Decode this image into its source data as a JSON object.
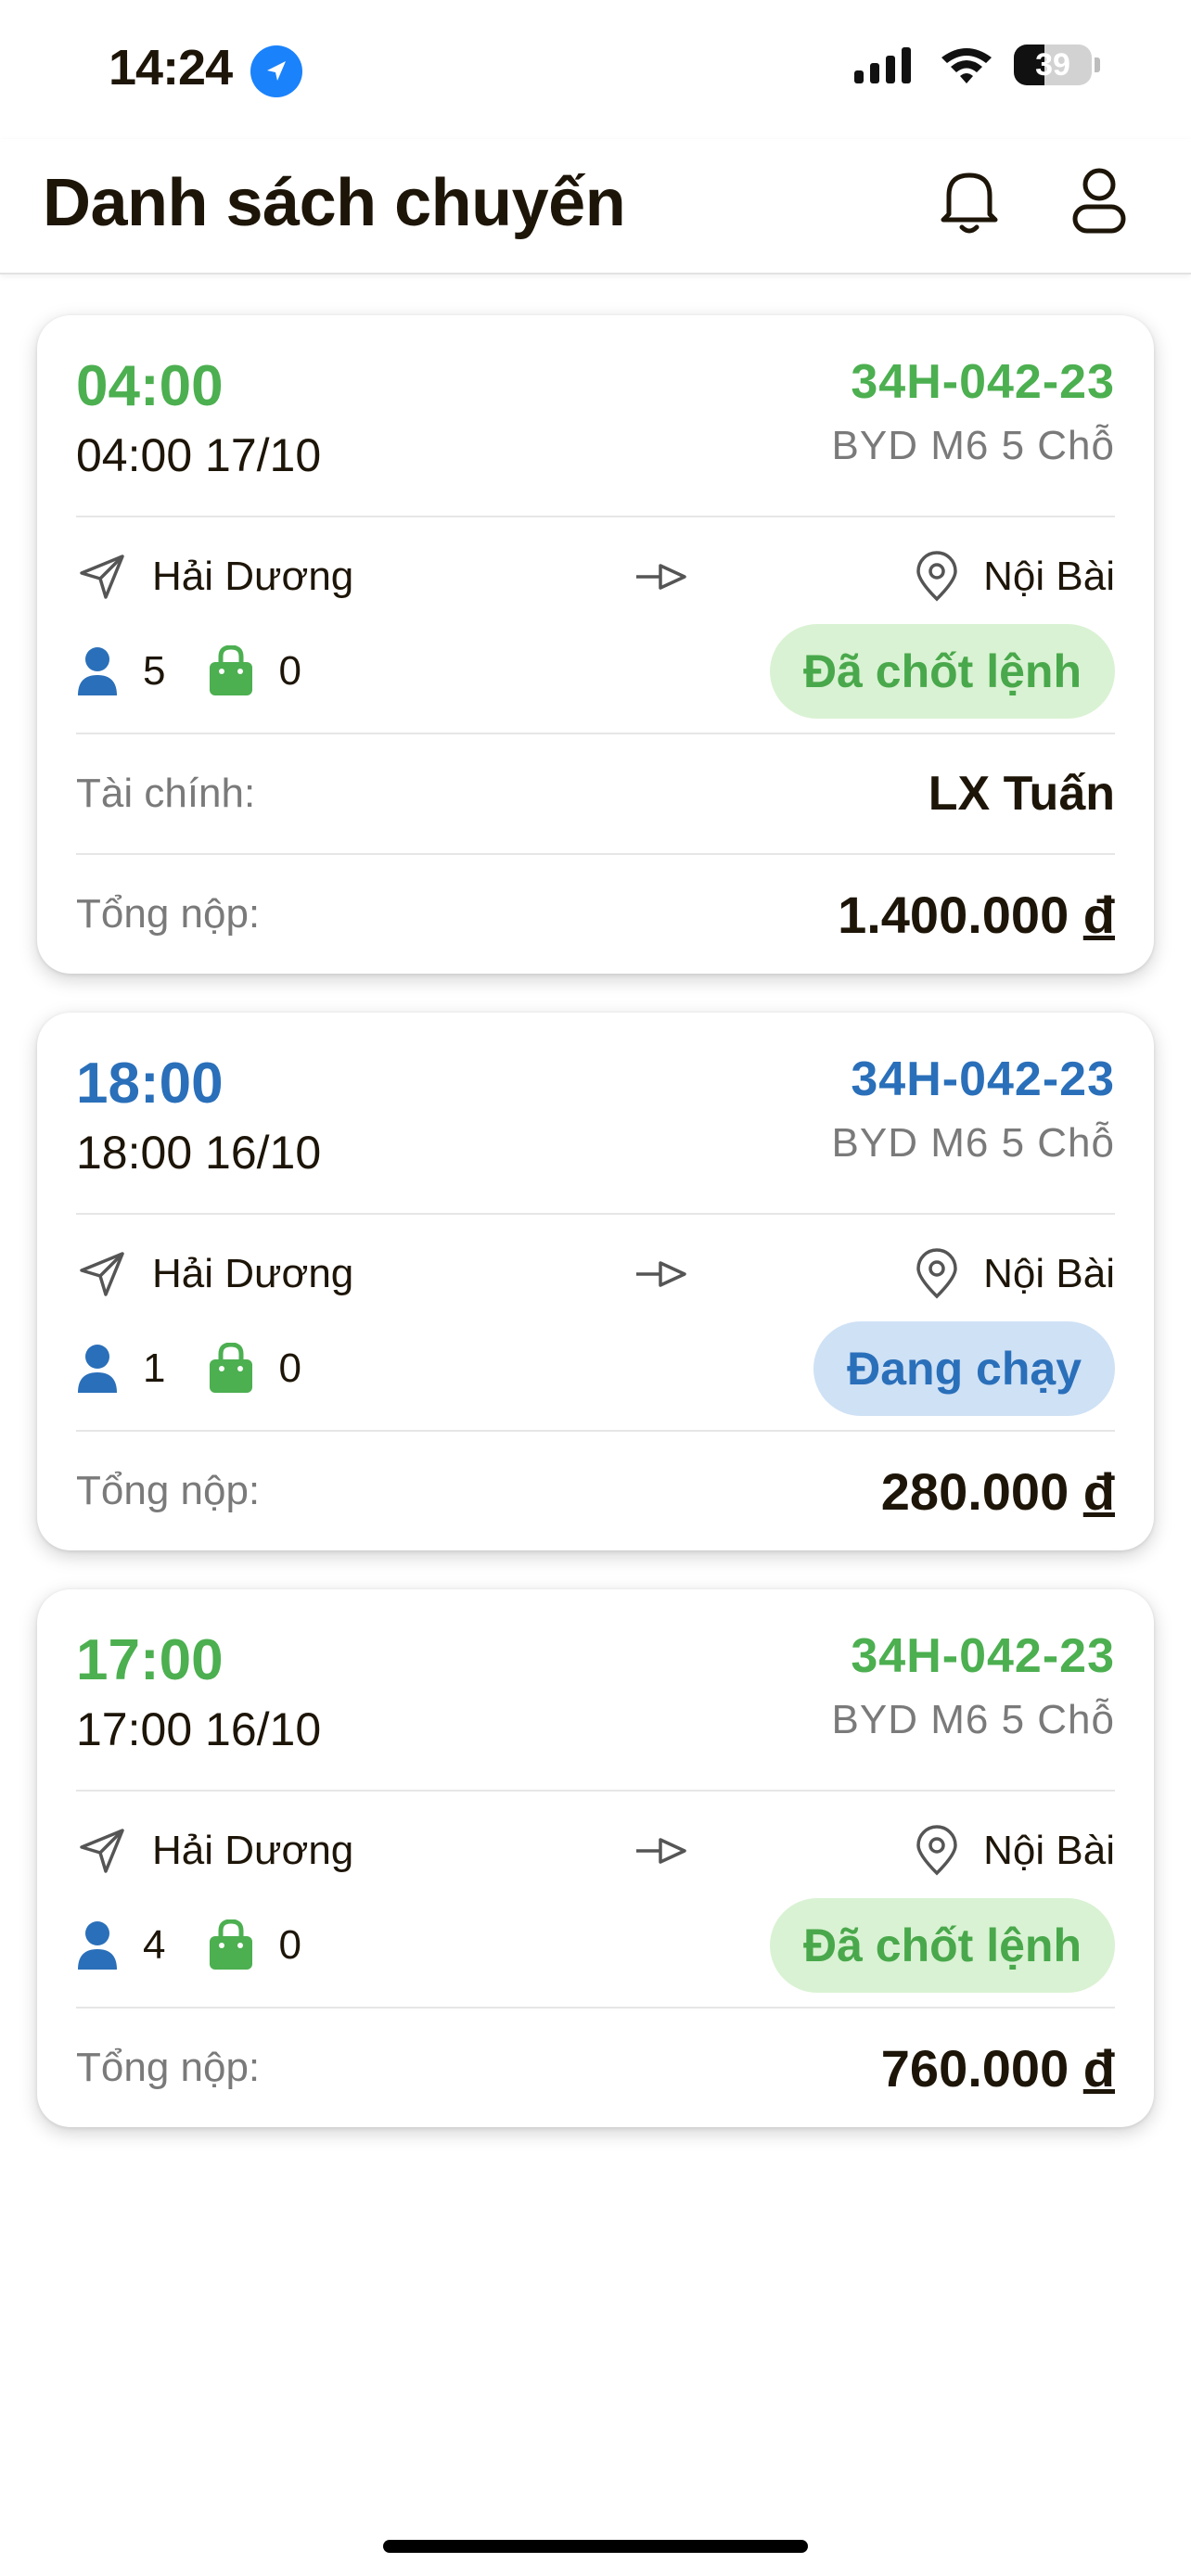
{
  "status_bar": {
    "time": "14:24",
    "battery": "39"
  },
  "header": {
    "title": "Danh sách chuyến",
    "icons": [
      "bell-icon",
      "user-icon"
    ]
  },
  "labels": {
    "finance": "Tài chính:",
    "total": "Tổng nộp:",
    "currency": "đ"
  },
  "colors": {
    "green": "#4caf50",
    "blue": "#2a6fb9",
    "badge_green_bg": "#d9f2d3",
    "badge_blue_bg": "#cfe1f5"
  },
  "trips": [
    {
      "time": "04:00",
      "datetime": "04:00 17/10",
      "plate": "34H-042-23",
      "vehicle": "BYD M6 5 Chỗ",
      "from": "Hải Dương",
      "to": "Nội Bài",
      "passengers": "5",
      "bags": "0",
      "status": "Đã chốt lệnh",
      "color": "green",
      "finance": "LX Tuấn",
      "total": "1.400.000"
    },
    {
      "time": "18:00",
      "datetime": "18:00 16/10",
      "plate": "34H-042-23",
      "vehicle": "BYD M6 5 Chỗ",
      "from": "Hải Dương",
      "to": "Nội Bài",
      "passengers": "1",
      "bags": "0",
      "status": "Đang chạy",
      "color": "blue",
      "total": "280.000"
    },
    {
      "time": "17:00",
      "datetime": "17:00 16/10",
      "plate": "34H-042-23",
      "vehicle": "BYD M6 5 Chỗ",
      "from": "Hải Dương",
      "to": "Nội Bài",
      "passengers": "4",
      "bags": "0",
      "status": "Đã chốt lệnh",
      "color": "green",
      "total": "760.000"
    }
  ]
}
